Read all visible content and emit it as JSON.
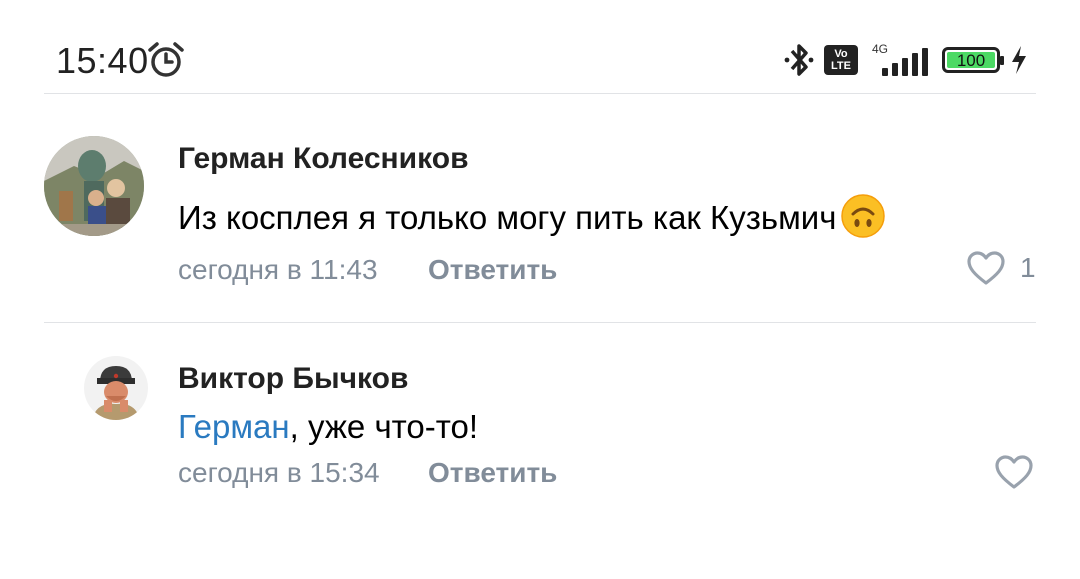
{
  "status_bar": {
    "time": "15:40",
    "network": "4G",
    "volte_top": "Vo",
    "volte_bottom": "LTE",
    "battery": "100"
  },
  "comments": [
    {
      "author": "Герман Колесников",
      "text": "Из косплея я только могу пить как Кузьмич",
      "emoji": "upside-down-face",
      "time": "сегодня в 11:43",
      "reply_label": "Ответить",
      "likes": "1"
    },
    {
      "author": "Виктор Бычков",
      "mention": "Герман",
      "text": ", уже что-то!",
      "time": "сегодня в 15:34",
      "reply_label": "Ответить"
    }
  ],
  "colors": {
    "mention": "#2a7ac0",
    "meta": "#818c99",
    "battery_fill": "#4cd964"
  }
}
